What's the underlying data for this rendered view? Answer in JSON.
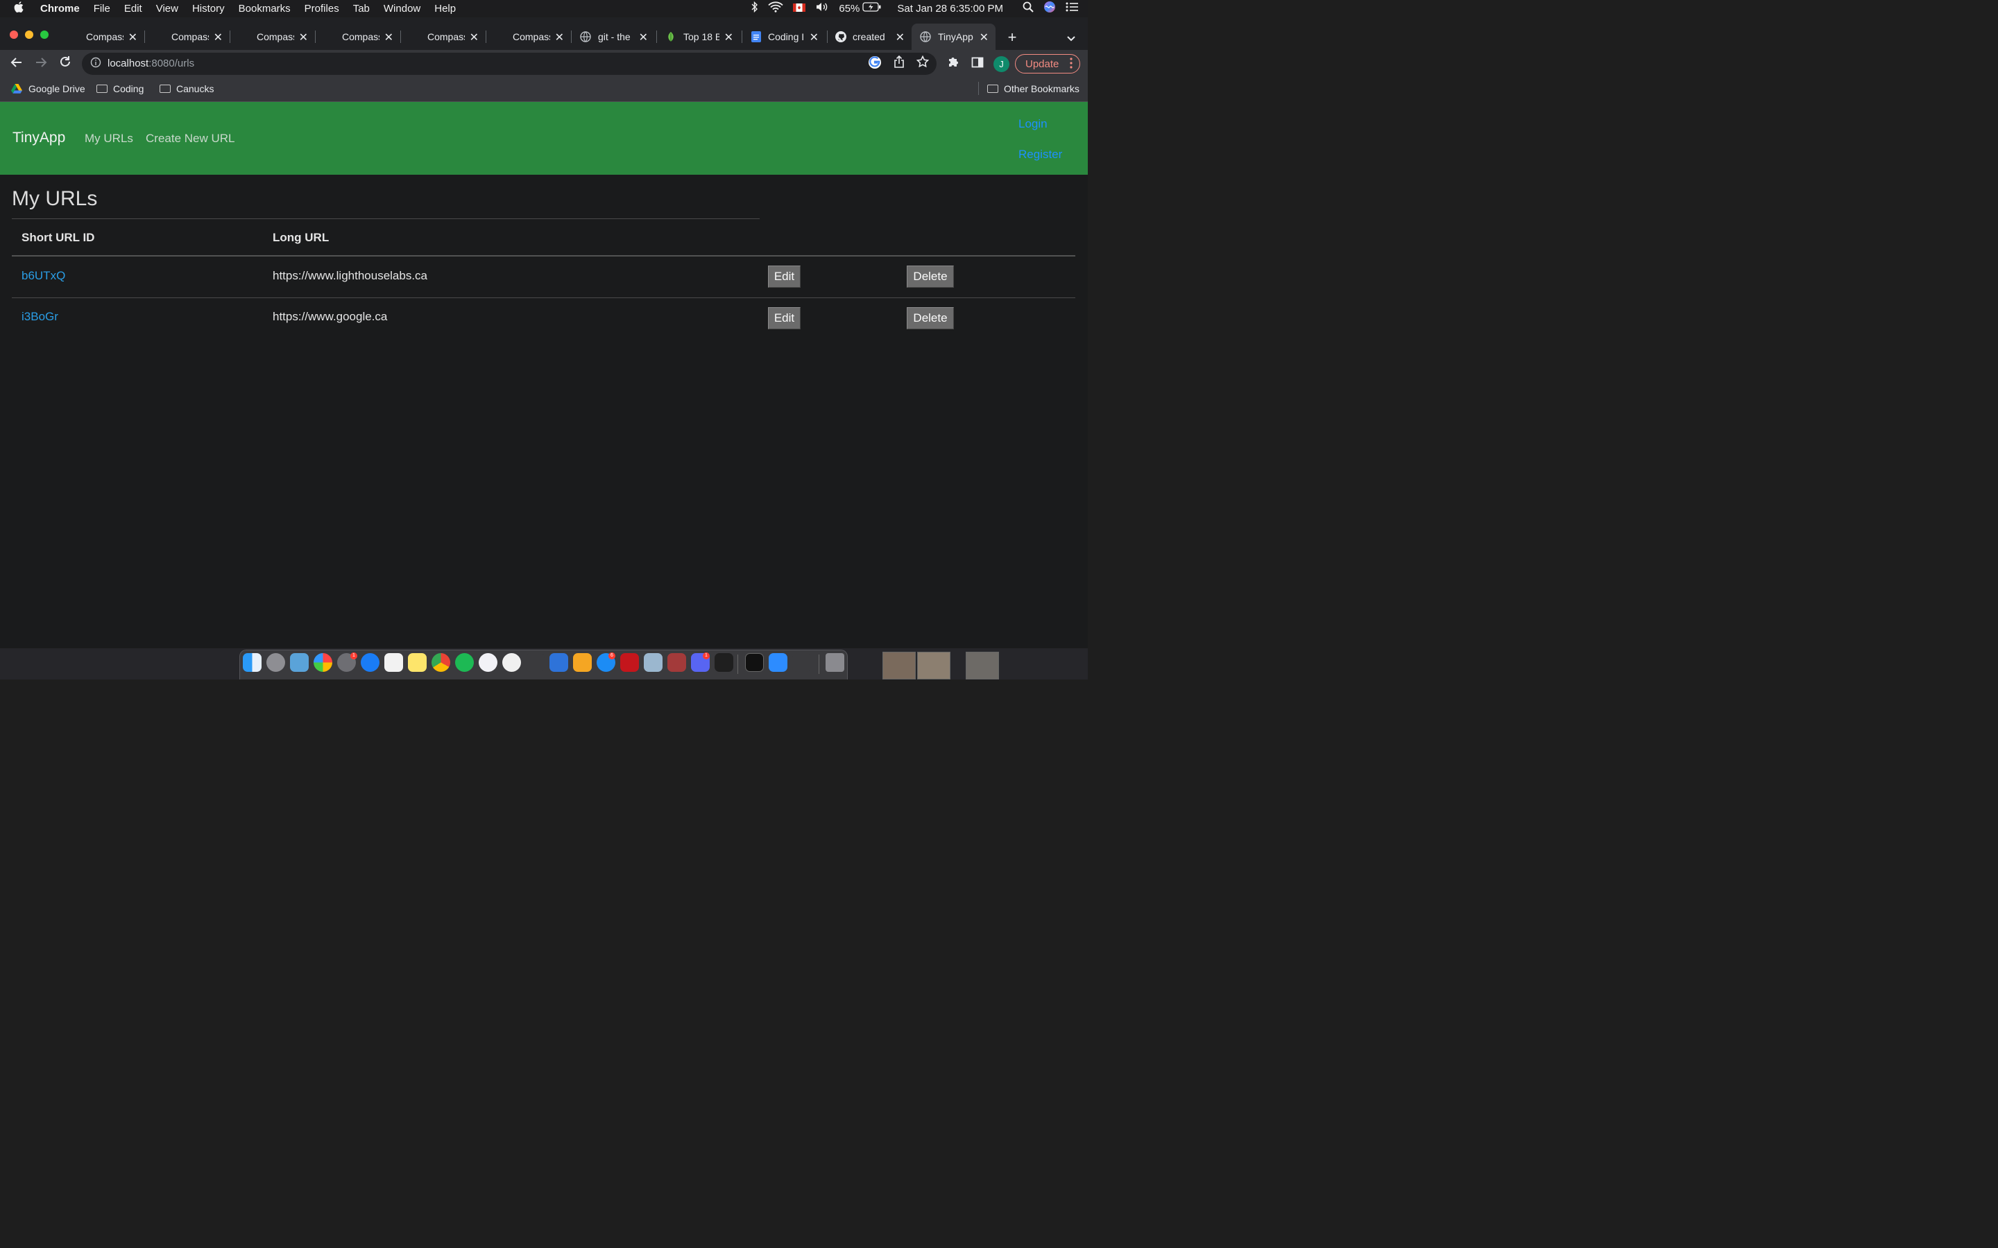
{
  "menubar": {
    "app_name": "Chrome",
    "items": [
      "File",
      "Edit",
      "View",
      "History",
      "Bookmarks",
      "Profiles",
      "Tab",
      "Window",
      "Help"
    ],
    "battery": "65%",
    "clock": "Sat Jan 28  6:35:00 PM"
  },
  "tabs": [
    {
      "title": "Compass",
      "active": false
    },
    {
      "title": "Compass",
      "active": false
    },
    {
      "title": "Compass",
      "active": false
    },
    {
      "title": "Compass",
      "active": false
    },
    {
      "title": "Compass",
      "active": false
    },
    {
      "title": "Compass",
      "active": false
    },
    {
      "title": "git - the",
      "active": false
    },
    {
      "title": "Top 18 B",
      "active": false
    },
    {
      "title": "Coding I",
      "active": false
    },
    {
      "title": "created",
      "active": false
    },
    {
      "title": "TinyApp",
      "active": true
    }
  ],
  "toolbar": {
    "url_host": "localhost",
    "url_rest": ":8080/urls",
    "update_label": "Update",
    "avatar_letter": "J"
  },
  "bookmarks": {
    "items": [
      "Google Drive",
      "Coding",
      "Canucks"
    ],
    "other": "Other Bookmarks"
  },
  "app": {
    "brand": "TinyApp",
    "nav": [
      "My URLs",
      "Create New URL"
    ],
    "login": "Login",
    "register": "Register",
    "heading": "My URLs",
    "columns": [
      "Short URL ID",
      "Long URL"
    ],
    "rows": [
      {
        "short": "b6UTxQ",
        "long": "https://www.lighthouselabs.ca"
      },
      {
        "short": "i3BoGr",
        "long": "https://www.google.ca"
      }
    ],
    "edit_label": "Edit",
    "delete_label": "Delete"
  },
  "colors": {
    "navbar": "#2a883e",
    "link": "#1e90ff",
    "short_link": "#2a9ee6",
    "button": "#6b6b6b"
  }
}
